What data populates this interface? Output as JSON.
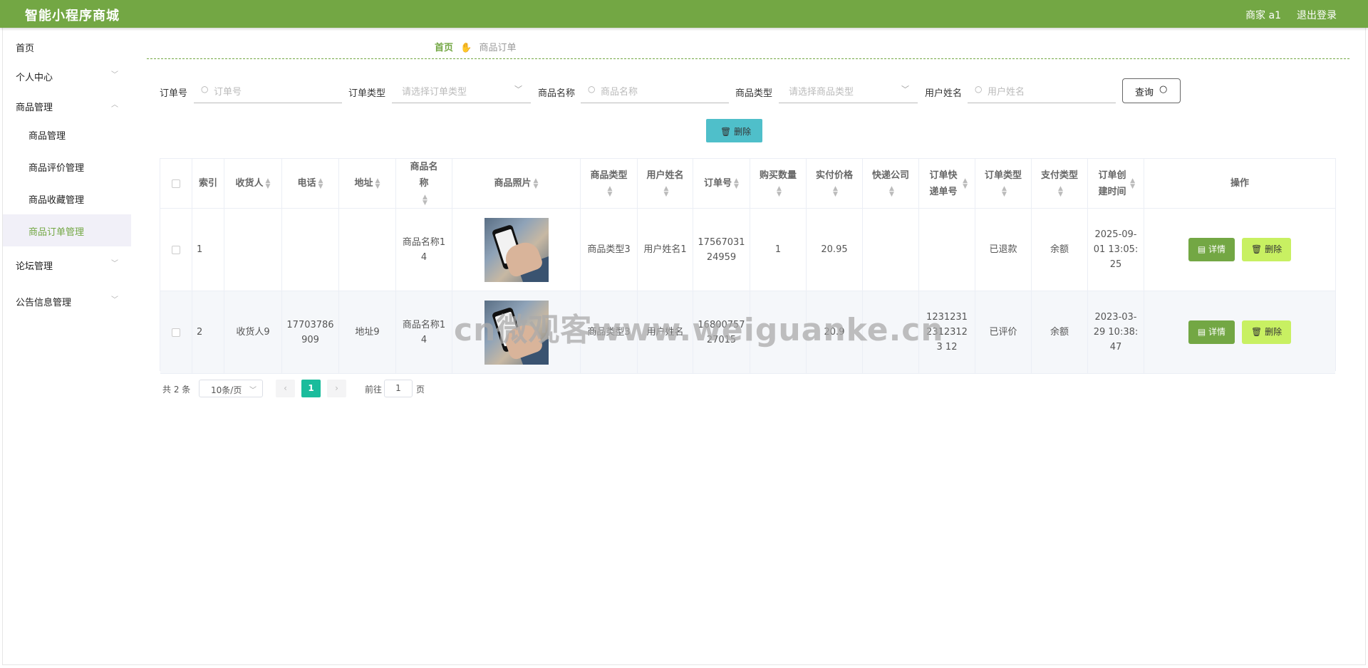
{
  "app": {
    "title": "智能小程序商城",
    "user": "商家 a1",
    "logout": "退出登录"
  },
  "sidebar": {
    "items": [
      {
        "label": "首页"
      },
      {
        "label": "个人中心",
        "chevron": "v"
      },
      {
        "label": "商品管理",
        "chevron": "^"
      },
      {
        "label": "论坛管理",
        "chevron": "v"
      },
      {
        "label": "公告信息管理",
        "chevron": "v"
      }
    ],
    "sub": [
      {
        "label": "商品管理"
      },
      {
        "label": "商品评价管理"
      },
      {
        "label": "商品收藏管理"
      },
      {
        "label": "商品订单管理"
      }
    ]
  },
  "breadcrumb": {
    "home": "首页",
    "current": "商品订单"
  },
  "filters": {
    "order_no": {
      "label": "订单号",
      "placeholder": "订单号"
    },
    "order_type": {
      "label": "订单类型",
      "placeholder": "请选择订单类型"
    },
    "product_name": {
      "label": "商品名称",
      "placeholder": "商品名称"
    },
    "product_type": {
      "label": "商品类型",
      "placeholder": "请选择商品类型"
    },
    "user_name": {
      "label": "用户姓名",
      "placeholder": "用户姓名"
    },
    "query_label": "查询",
    "delete_label": "删除"
  },
  "table": {
    "headers": {
      "index": "索引",
      "receiver": "收货人",
      "phone": "电话",
      "address": "地址",
      "product_name": "商品名称",
      "photo": "商品照片",
      "product_type": "商品类型",
      "user_name": "用户姓名",
      "order_no": "订单号",
      "quantity": "购买数量",
      "price": "实付价格",
      "express": "快递公司",
      "express_no": "订单快递单号",
      "order_type": "订单类型",
      "pay_type": "支付类型",
      "created": "订单创建时间",
      "ops": "操作"
    },
    "rows": [
      {
        "index": "1",
        "receiver": "",
        "phone": "",
        "address": "",
        "product_name": "商品名称14",
        "product_type": "商品类型3",
        "user_name": "用户姓名1",
        "order_no": "1756703124959",
        "quantity": "1",
        "price": "20.95",
        "express": "",
        "express_no": "",
        "order_type": "已退款",
        "pay_type": "余额",
        "created": "2025-09-01 13:05:25"
      },
      {
        "index": "2",
        "receiver": "收货人9",
        "phone": "17703786909",
        "address": "地址9",
        "product_name": "商品名称14",
        "product_type": "商品类型3",
        "user_name": "用户姓名",
        "order_no": "1680075727015",
        "quantity": "",
        "price": "20.9",
        "express": "",
        "express_no": "123123123123123 12",
        "order_type": "已评价",
        "pay_type": "余额",
        "created": "2023-03-29 10:38:47"
      }
    ],
    "detail_label": "详情",
    "delete_label": "删除"
  },
  "pagination": {
    "total": "共 2 条",
    "page_size": "10条/页",
    "current": "1",
    "goto_prefix": "前往",
    "goto_value": "1",
    "goto_suffix": "页"
  },
  "watermark": "cn微观客www.weiguanke.cn",
  "colors": {
    "brand": "#73a744",
    "delete_button": "#4fbfca",
    "row_delete": "#c8f062",
    "pager_active": "#1abc9c"
  }
}
